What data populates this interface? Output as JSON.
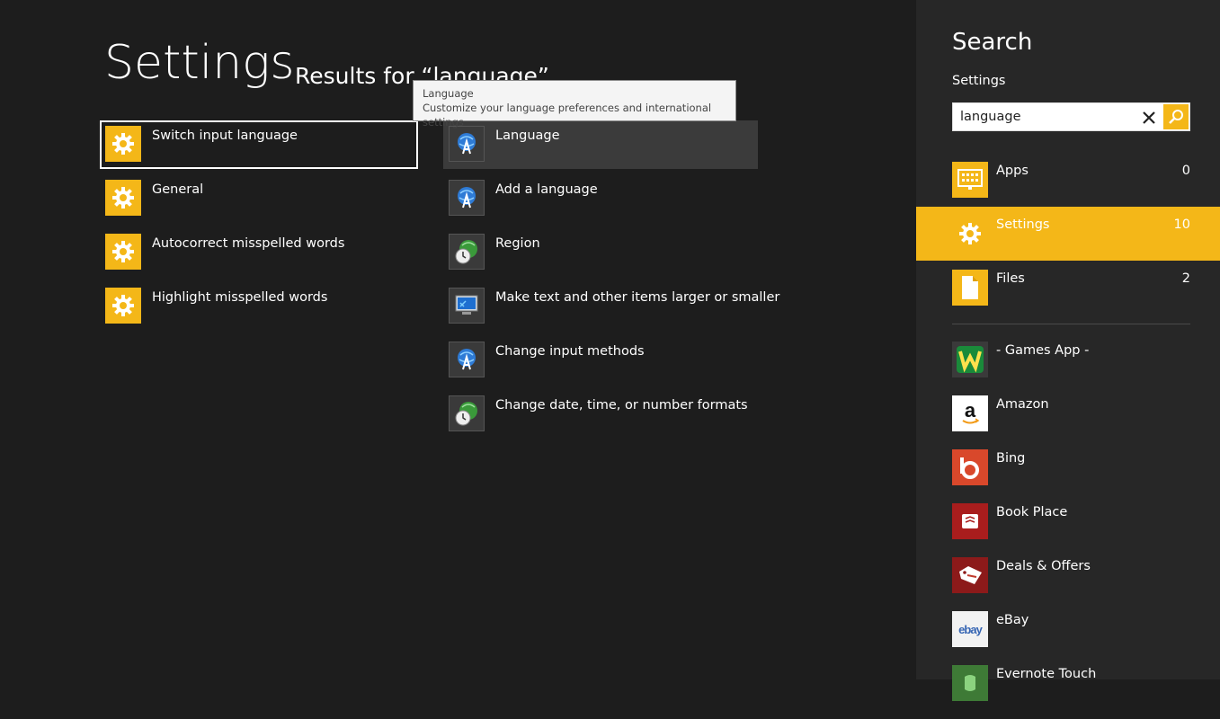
{
  "main": {
    "title": "Settings",
    "results_for": "Results for “language”",
    "left_results": [
      {
        "label": "Switch input language",
        "icon": "gear-icon"
      },
      {
        "label": "General",
        "icon": "gear-icon"
      },
      {
        "label": "Autocorrect misspelled words",
        "icon": "gear-icon"
      },
      {
        "label": "Highlight misspelled words",
        "icon": "gear-icon"
      }
    ],
    "right_results": [
      {
        "label": "Language",
        "icon": "language-globe-icon"
      },
      {
        "label": "Add a language",
        "icon": "language-globe-icon"
      },
      {
        "label": "Region",
        "icon": "region-clock-globe-icon"
      },
      {
        "label": "Make text and other items larger or smaller",
        "icon": "display-monitor-icon"
      },
      {
        "label": "Change input methods",
        "icon": "language-globe-icon"
      },
      {
        "label": "Change date, time, or number formats",
        "icon": "region-clock-globe-icon"
      }
    ],
    "tooltip": {
      "title": "Language",
      "description": "Customize your language preferences and international settings"
    }
  },
  "pane": {
    "title": "Search",
    "scope": "Settings",
    "search": {
      "value": "language",
      "placeholder": ""
    },
    "scopes": [
      {
        "label": "Apps",
        "count": "0",
        "icon": "apps-grid-icon"
      },
      {
        "label": "Settings",
        "count": "10",
        "icon": "gear-icon"
      },
      {
        "label": "Files",
        "count": "2",
        "icon": "file-icon"
      }
    ],
    "apps": [
      {
        "label": "- Games App -",
        "icon": "games-app-icon"
      },
      {
        "label": "Amazon",
        "icon": "amazon-icon"
      },
      {
        "label": "Bing",
        "icon": "bing-icon"
      },
      {
        "label": "Book Place",
        "icon": "book-place-icon"
      },
      {
        "label": "Deals & Offers",
        "icon": "deals-icon"
      },
      {
        "label": "eBay",
        "icon": "ebay-icon",
        "logo_text": "ebay"
      },
      {
        "label": "Evernote Touch",
        "icon": "evernote-icon"
      }
    ]
  },
  "colors": {
    "accent": "#f4b718",
    "background": "#1d1d1d",
    "pane": "#272727"
  }
}
